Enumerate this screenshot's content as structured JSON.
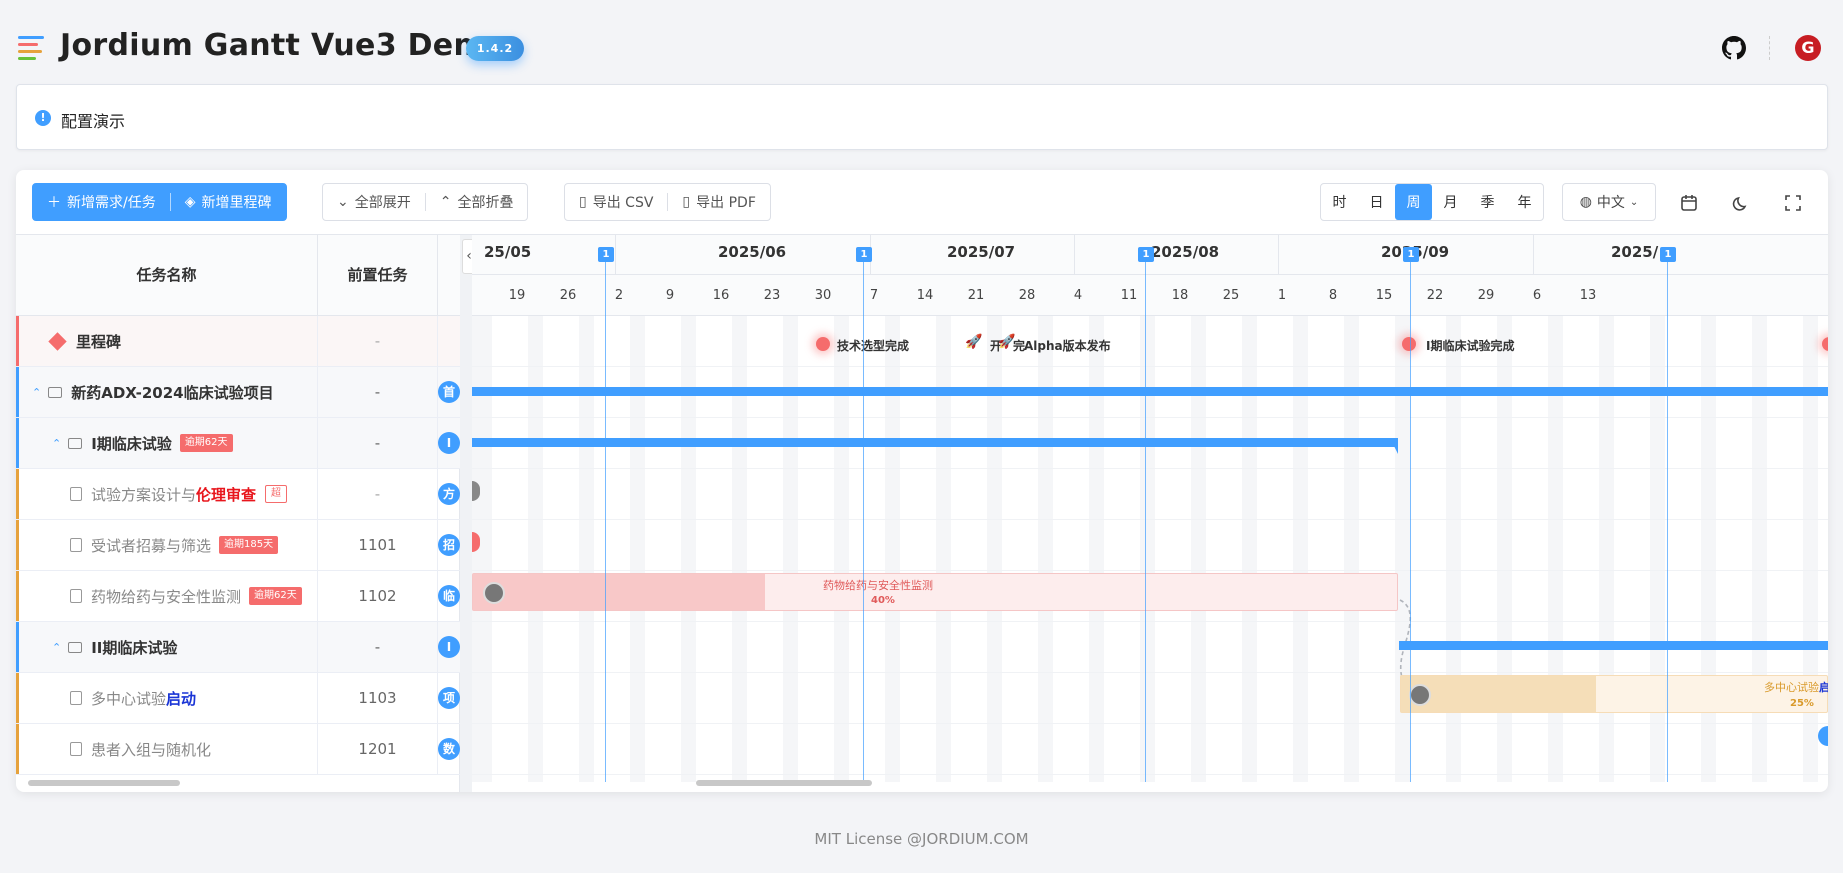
{
  "header": {
    "title": "Jordium Gantt Vue3 Demo",
    "version": "1.4.2"
  },
  "config": {
    "icon": "!",
    "title": "配置演示"
  },
  "toolbar": {
    "add_task": "新增需求/任务",
    "add_milestone": "新增里程碑",
    "expand_all": "全部展开",
    "collapse_all": "全部折叠",
    "export_csv": "导出 CSV",
    "export_pdf": "导出 PDF",
    "scales": [
      "时",
      "日",
      "周",
      "月",
      "季",
      "年"
    ],
    "active_scale": "周",
    "language": "中文"
  },
  "table": {
    "headers": {
      "name": "任务名称",
      "predecessor": "前置任务"
    },
    "rows": [
      {
        "name": "里程碑",
        "pre": "-",
        "kind": "milestone",
        "color": "#f56c6c"
      },
      {
        "name": "新药ADX-2024临床试验项目",
        "pre": "-",
        "kind": "project",
        "badge": "首",
        "color": "#409eff"
      },
      {
        "name": "I期临床试验",
        "pre": "-",
        "kind": "phase",
        "badge": "I",
        "tag": "逾期62天",
        "color": "#409eff"
      },
      {
        "name_a": "试验方案设计与",
        "name_b": "伦理审查",
        "pre": "-",
        "kind": "task",
        "badge": "方",
        "tag": "超",
        "color": "#e6a23c"
      },
      {
        "name": "受试者招募与筛选",
        "pre": "1101",
        "kind": "task",
        "badge": "招",
        "tag": "逾期185天",
        "color": "#e6a23c"
      },
      {
        "name": "药物给药与安全性监测",
        "pre": "1102",
        "kind": "task",
        "badge": "临",
        "tag": "逾期62天",
        "color": "#e6a23c"
      },
      {
        "name": "II期临床试验",
        "pre": "-",
        "kind": "phase",
        "badge": "I",
        "color": "#409eff"
      },
      {
        "name_a": "多中心试验",
        "name_b": "启动",
        "pre": "1103",
        "kind": "task",
        "badge": "项",
        "color": "#e6a23c"
      },
      {
        "name": "患者入组与随机化",
        "pre": "1201",
        "kind": "task",
        "badge": "数",
        "color": "#e6a23c"
      }
    ]
  },
  "timeline": {
    "months": [
      "25/05",
      "2025/06",
      "2025/07",
      "2025/08",
      "2025/09",
      "2025/"
    ],
    "weeks": [
      "19",
      "26",
      "2",
      "9",
      "16",
      "23",
      "30",
      "7",
      "14",
      "21",
      "28",
      "4",
      "11",
      "18",
      "25",
      "1",
      "8",
      "15",
      "22",
      "29",
      "6",
      "13"
    ],
    "marker_label": "1",
    "milestones": [
      "技术选型完成",
      "开",
      "完",
      "Alpha版本发布",
      "I期临床试验完成"
    ],
    "bars": {
      "drug_task": {
        "name": "药物给药与安全性监测",
        "progress": "40%"
      },
      "multi_center": {
        "name_a": "多中心试验",
        "name_b": "启",
        "progress": "25%"
      }
    }
  },
  "footer": "MIT License @JORDIUM.COM"
}
